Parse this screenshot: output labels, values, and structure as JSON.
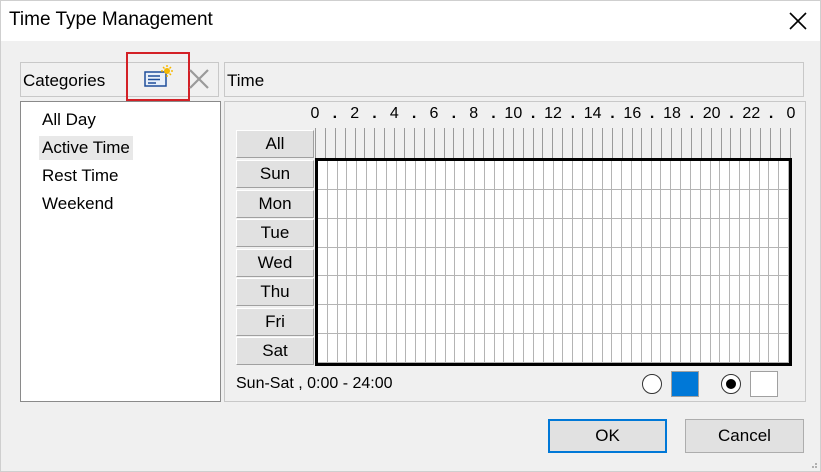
{
  "window": {
    "title": "Time Type Management"
  },
  "categories": {
    "header": "Categories",
    "items": [
      {
        "label": "All Day",
        "selected": false
      },
      {
        "label": "Active Time",
        "selected": true
      },
      {
        "label": "Rest Time",
        "selected": false
      },
      {
        "label": "Weekend",
        "selected": false
      }
    ]
  },
  "time": {
    "header": "Time",
    "hour_labels": [
      "0",
      ".",
      "2",
      ".",
      "4",
      ".",
      "6",
      ".",
      "8",
      ".",
      "10",
      ".",
      "12",
      ".",
      "14",
      ".",
      "16",
      ".",
      "18",
      ".",
      "20",
      ".",
      "22",
      ".",
      "0"
    ],
    "all_label": "All",
    "days": [
      "Sun",
      "Mon",
      "Tue",
      "Wed",
      "Thu",
      "Fri",
      "Sat"
    ],
    "status": "Sun-Sat , 0:00 - 24:00",
    "slots_per_day": 48,
    "active_color": "#0078d7",
    "inactive_color": "#ffffff",
    "selected_mode": "inactive"
  },
  "buttons": {
    "ok": "OK",
    "cancel": "Cancel"
  },
  "icons": {
    "add": "add-category-icon",
    "delete": "delete-category-icon",
    "close": "close-icon"
  },
  "colors": {
    "highlight": "#d32026"
  }
}
